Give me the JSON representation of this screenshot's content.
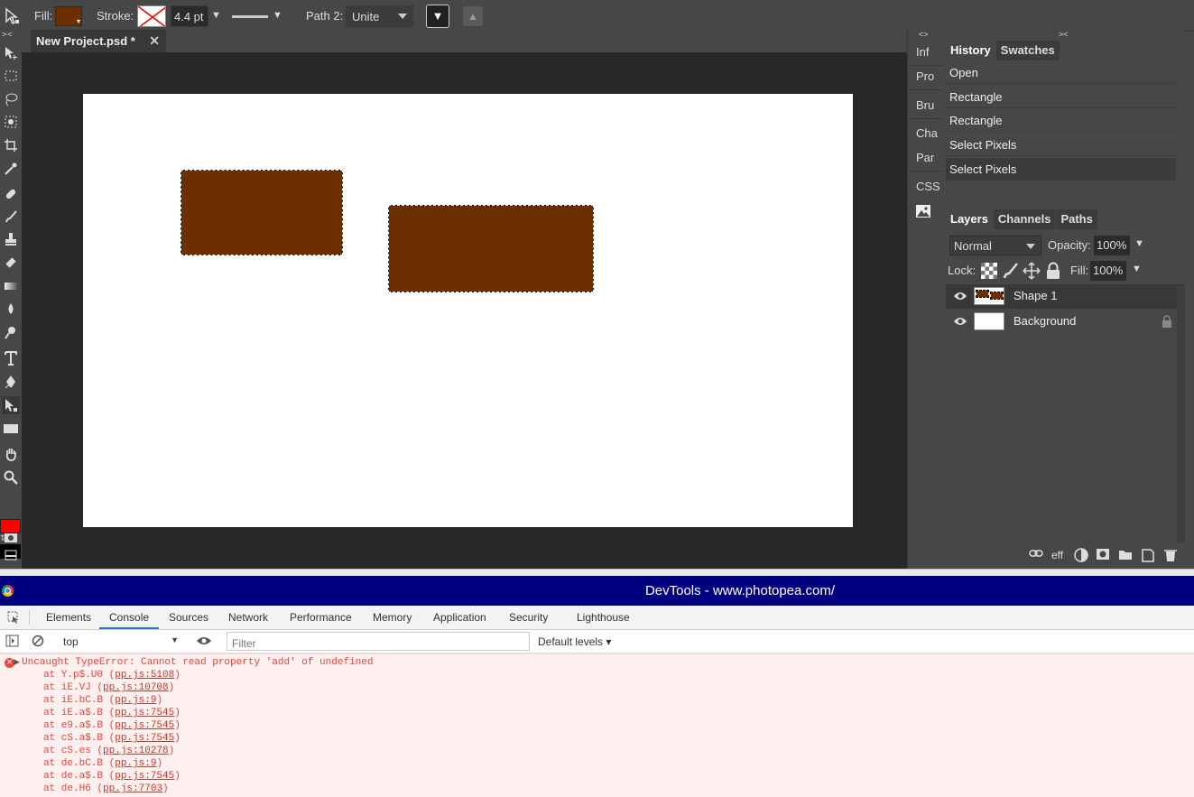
{
  "options_bar": {
    "fill_label": "Fill:",
    "fill_color": "#6e2f00",
    "stroke_label": "Stroke:",
    "stroke_width": "4.4 pt",
    "path_label": "Path 2:",
    "path_op": "Unite"
  },
  "document": {
    "tab_title": "New Project.psd *",
    "close_glyph": "✕",
    "shape_color": "#6e2f00"
  },
  "side_labels": [
    "Inf",
    "Pro",
    "Bru",
    "Cha",
    "Par",
    "CSS"
  ],
  "history_panel": {
    "tabs": [
      "History",
      "Swatches"
    ],
    "items": [
      "Open",
      "Rectangle",
      "Rectangle",
      "Select Pixels",
      "Select Pixels"
    ]
  },
  "layers_panel": {
    "tabs": [
      "Layers",
      "Channels",
      "Paths"
    ],
    "blend_mode": "Normal",
    "opacity_label": "Opacity:",
    "opacity_value": "100%",
    "lock_label": "Lock:",
    "fill_label": "Fill:",
    "fill_value": "100%",
    "layers": [
      "Shape 1",
      "Background"
    ],
    "footer_eff": "eff"
  },
  "devtools": {
    "title": "DevTools - www.photopea.com/",
    "tabs": [
      "Elements",
      "Console",
      "Sources",
      "Network",
      "Performance",
      "Memory",
      "Application",
      "Security",
      "Lighthouse"
    ],
    "active_tab": "Console",
    "context": "top",
    "filter_placeholder": "Filter",
    "levels": "Default levels ▾",
    "error_message": "Uncaught TypeError: Cannot read property 'add' of undefined",
    "stack": [
      {
        "fn": "at Y.p$.U0 (",
        "loc": "pp.js:5108",
        "end": ")"
      },
      {
        "fn": "at iE.VJ (",
        "loc": "pp.js:10708",
        "end": ")"
      },
      {
        "fn": "at iE.bC.B (",
        "loc": "pp.js:9",
        "end": ")"
      },
      {
        "fn": "at iE.a$.B (",
        "loc": "pp.js:7545",
        "end": ")"
      },
      {
        "fn": "at e9.a$.B (",
        "loc": "pp.js:7545",
        "end": ")"
      },
      {
        "fn": "at cS.a$.B (",
        "loc": "pp.js:7545",
        "end": ")"
      },
      {
        "fn": "at cS.es (",
        "loc": "pp.js:10278",
        "end": ")"
      },
      {
        "fn": "at de.bC.B (",
        "loc": "pp.js:9",
        "end": ")"
      },
      {
        "fn": "at de.a$.B (",
        "loc": "pp.js:7545",
        "end": ")"
      },
      {
        "fn": "at de.H6 (",
        "loc": "pp.js:7703",
        "end": ")"
      }
    ]
  },
  "colors": {
    "foreground": "#ff0000",
    "background": "#000000",
    "error": "#e8453c",
    "devtools_title_bg": "#000080"
  }
}
